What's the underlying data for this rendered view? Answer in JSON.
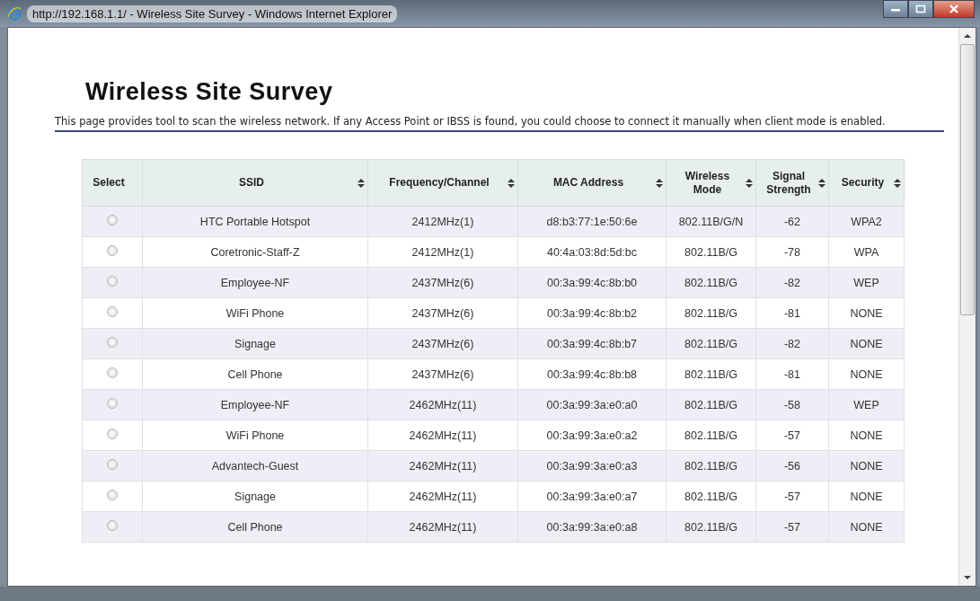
{
  "window": {
    "title": "http://192.168.1.1/ - Wireless Site Survey - Windows Internet Explorer"
  },
  "page": {
    "heading": "Wireless Site Survey",
    "description": "This page provides tool to scan the wireless network. If any Access Point or IBSS is found, you could choose to connect it manually when client mode is enabled."
  },
  "table": {
    "columns": [
      {
        "label": "Select",
        "sortable": false
      },
      {
        "label": "SSID",
        "sortable": true
      },
      {
        "label": "Frequency/Channel",
        "sortable": true
      },
      {
        "label": "MAC Address",
        "sortable": true
      },
      {
        "label": "Wireless Mode",
        "sortable": true
      },
      {
        "label": "Signal Strength",
        "sortable": true
      },
      {
        "label": "Security",
        "sortable": true
      }
    ],
    "rows": [
      {
        "selected": false,
        "ssid": "HTC Portable Hotspot",
        "frequency": "2412MHz(1)",
        "mac": "d8:b3:77:1e:50:6e",
        "mode": "802.11B/G/N",
        "signal": "-62",
        "security": "WPA2"
      },
      {
        "selected": false,
        "ssid": "Coretronic-Staff-Z",
        "frequency": "2412MHz(1)",
        "mac": "40:4a:03:8d:5d:bc",
        "mode": "802.11B/G",
        "signal": "-78",
        "security": "WPA"
      },
      {
        "selected": false,
        "ssid": "Employee-NF",
        "frequency": "2437MHz(6)",
        "mac": "00:3a:99:4c:8b:b0",
        "mode": "802.11B/G",
        "signal": "-82",
        "security": "WEP"
      },
      {
        "selected": false,
        "ssid": "WiFi Phone",
        "frequency": "2437MHz(6)",
        "mac": "00:3a:99:4c:8b:b2",
        "mode": "802.11B/G",
        "signal": "-81",
        "security": "NONE"
      },
      {
        "selected": false,
        "ssid": "Signage",
        "frequency": "2437MHz(6)",
        "mac": "00:3a:99:4c:8b:b7",
        "mode": "802.11B/G",
        "signal": "-82",
        "security": "NONE"
      },
      {
        "selected": false,
        "ssid": "Cell Phone",
        "frequency": "2437MHz(6)",
        "mac": "00:3a:99:4c:8b:b8",
        "mode": "802.11B/G",
        "signal": "-81",
        "security": "NONE"
      },
      {
        "selected": false,
        "ssid": "Employee-NF",
        "frequency": "2462MHz(11)",
        "mac": "00:3a:99:3a:e0:a0",
        "mode": "802.11B/G",
        "signal": "-58",
        "security": "WEP"
      },
      {
        "selected": false,
        "ssid": "WiFi Phone",
        "frequency": "2462MHz(11)",
        "mac": "00:3a:99:3a:e0:a2",
        "mode": "802.11B/G",
        "signal": "-57",
        "security": "NONE"
      },
      {
        "selected": false,
        "ssid": "Advantech-Guest",
        "frequency": "2462MHz(11)",
        "mac": "00:3a:99:3a:e0:a3",
        "mode": "802.11B/G",
        "signal": "-56",
        "security": "NONE"
      },
      {
        "selected": false,
        "ssid": "Signage",
        "frequency": "2462MHz(11)",
        "mac": "00:3a:99:3a:e0:a7",
        "mode": "802.11B/G",
        "signal": "-57",
        "security": "NONE"
      },
      {
        "selected": false,
        "ssid": "Cell Phone",
        "frequency": "2462MHz(11)",
        "mac": "00:3a:99:3a:e0:a8",
        "mode": "802.11B/G",
        "signal": "-57",
        "security": "NONE"
      }
    ]
  }
}
